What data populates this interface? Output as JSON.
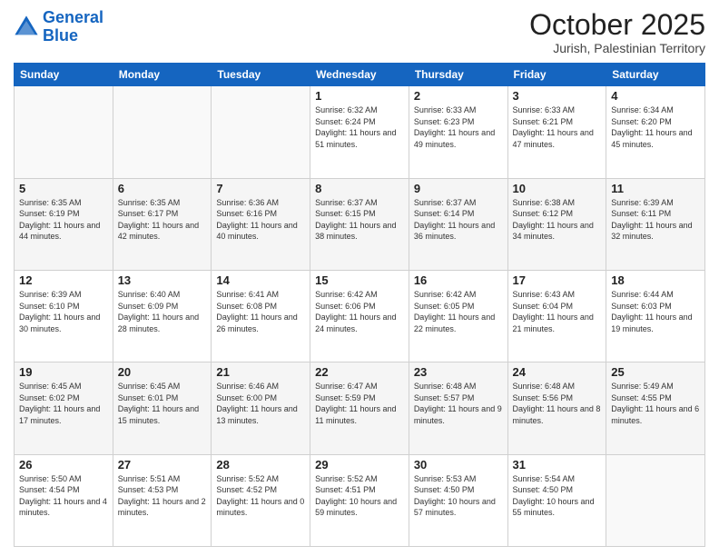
{
  "logo": {
    "line1": "General",
    "line2": "Blue"
  },
  "header": {
    "month": "October 2025",
    "location": "Jurish, Palestinian Territory"
  },
  "weekdays": [
    "Sunday",
    "Monday",
    "Tuesday",
    "Wednesday",
    "Thursday",
    "Friday",
    "Saturday"
  ],
  "weeks": [
    [
      {
        "day": null
      },
      {
        "day": null
      },
      {
        "day": null
      },
      {
        "day": "1",
        "sunrise": "6:32 AM",
        "sunset": "6:24 PM",
        "daylight": "11 hours and 51 minutes."
      },
      {
        "day": "2",
        "sunrise": "6:33 AM",
        "sunset": "6:23 PM",
        "daylight": "11 hours and 49 minutes."
      },
      {
        "day": "3",
        "sunrise": "6:33 AM",
        "sunset": "6:21 PM",
        "daylight": "11 hours and 47 minutes."
      },
      {
        "day": "4",
        "sunrise": "6:34 AM",
        "sunset": "6:20 PM",
        "daylight": "11 hours and 45 minutes."
      }
    ],
    [
      {
        "day": "5",
        "sunrise": "6:35 AM",
        "sunset": "6:19 PM",
        "daylight": "11 hours and 44 minutes."
      },
      {
        "day": "6",
        "sunrise": "6:35 AM",
        "sunset": "6:17 PM",
        "daylight": "11 hours and 42 minutes."
      },
      {
        "day": "7",
        "sunrise": "6:36 AM",
        "sunset": "6:16 PM",
        "daylight": "11 hours and 40 minutes."
      },
      {
        "day": "8",
        "sunrise": "6:37 AM",
        "sunset": "6:15 PM",
        "daylight": "11 hours and 38 minutes."
      },
      {
        "day": "9",
        "sunrise": "6:37 AM",
        "sunset": "6:14 PM",
        "daylight": "11 hours and 36 minutes."
      },
      {
        "day": "10",
        "sunrise": "6:38 AM",
        "sunset": "6:12 PM",
        "daylight": "11 hours and 34 minutes."
      },
      {
        "day": "11",
        "sunrise": "6:39 AM",
        "sunset": "6:11 PM",
        "daylight": "11 hours and 32 minutes."
      }
    ],
    [
      {
        "day": "12",
        "sunrise": "6:39 AM",
        "sunset": "6:10 PM",
        "daylight": "11 hours and 30 minutes."
      },
      {
        "day": "13",
        "sunrise": "6:40 AM",
        "sunset": "6:09 PM",
        "daylight": "11 hours and 28 minutes."
      },
      {
        "day": "14",
        "sunrise": "6:41 AM",
        "sunset": "6:08 PM",
        "daylight": "11 hours and 26 minutes."
      },
      {
        "day": "15",
        "sunrise": "6:42 AM",
        "sunset": "6:06 PM",
        "daylight": "11 hours and 24 minutes."
      },
      {
        "day": "16",
        "sunrise": "6:42 AM",
        "sunset": "6:05 PM",
        "daylight": "11 hours and 22 minutes."
      },
      {
        "day": "17",
        "sunrise": "6:43 AM",
        "sunset": "6:04 PM",
        "daylight": "11 hours and 21 minutes."
      },
      {
        "day": "18",
        "sunrise": "6:44 AM",
        "sunset": "6:03 PM",
        "daylight": "11 hours and 19 minutes."
      }
    ],
    [
      {
        "day": "19",
        "sunrise": "6:45 AM",
        "sunset": "6:02 PM",
        "daylight": "11 hours and 17 minutes."
      },
      {
        "day": "20",
        "sunrise": "6:45 AM",
        "sunset": "6:01 PM",
        "daylight": "11 hours and 15 minutes."
      },
      {
        "day": "21",
        "sunrise": "6:46 AM",
        "sunset": "6:00 PM",
        "daylight": "11 hours and 13 minutes."
      },
      {
        "day": "22",
        "sunrise": "6:47 AM",
        "sunset": "5:59 PM",
        "daylight": "11 hours and 11 minutes."
      },
      {
        "day": "23",
        "sunrise": "6:48 AM",
        "sunset": "5:57 PM",
        "daylight": "11 hours and 9 minutes."
      },
      {
        "day": "24",
        "sunrise": "6:48 AM",
        "sunset": "5:56 PM",
        "daylight": "11 hours and 8 minutes."
      },
      {
        "day": "25",
        "sunrise": "5:49 AM",
        "sunset": "4:55 PM",
        "daylight": "11 hours and 6 minutes."
      }
    ],
    [
      {
        "day": "26",
        "sunrise": "5:50 AM",
        "sunset": "4:54 PM",
        "daylight": "11 hours and 4 minutes."
      },
      {
        "day": "27",
        "sunrise": "5:51 AM",
        "sunset": "4:53 PM",
        "daylight": "11 hours and 2 minutes."
      },
      {
        "day": "28",
        "sunrise": "5:52 AM",
        "sunset": "4:52 PM",
        "daylight": "11 hours and 0 minutes."
      },
      {
        "day": "29",
        "sunrise": "5:52 AM",
        "sunset": "4:51 PM",
        "daylight": "10 hours and 59 minutes."
      },
      {
        "day": "30",
        "sunrise": "5:53 AM",
        "sunset": "4:50 PM",
        "daylight": "10 hours and 57 minutes."
      },
      {
        "day": "31",
        "sunrise": "5:54 AM",
        "sunset": "4:50 PM",
        "daylight": "10 hours and 55 minutes."
      },
      {
        "day": null
      }
    ]
  ]
}
